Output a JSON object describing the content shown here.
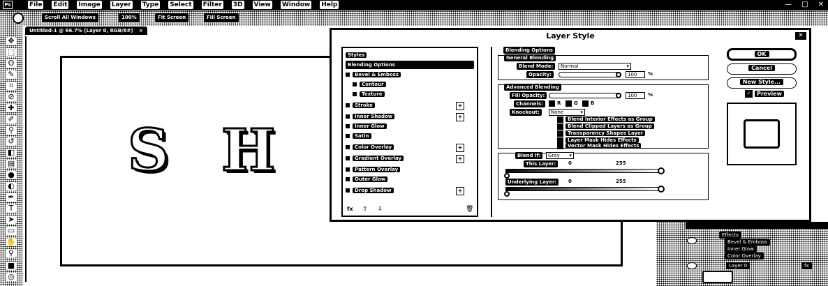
{
  "menubar": {
    "logo": "Ps",
    "items": [
      "File",
      "Edit",
      "Image",
      "Layer",
      "Type",
      "Select",
      "Filter",
      "3D",
      "View",
      "Window",
      "Help"
    ],
    "window_controls": [
      "—",
      "□",
      "✕"
    ]
  },
  "optbar": {
    "scroll_all": "Scroll All Windows",
    "zoom": "100%",
    "fit_screen": "Fit Screen",
    "fill_screen": "Fill Screen"
  },
  "doctab": {
    "title": "Untitled-1 @ 66.7% (Layer 0, RGB/8#)",
    "close": "×"
  },
  "canvas": {
    "letters": [
      "S",
      "H"
    ]
  },
  "dialog": {
    "title": "Layer Style",
    "close": "✕",
    "styles_header": "Styles",
    "styles": [
      {
        "label": "Blending Options",
        "selected": true,
        "checkbox": false,
        "plus": false
      },
      {
        "label": "Bevel & Emboss",
        "checkbox": true,
        "plus": false
      },
      {
        "label": "Contour",
        "checkbox": true,
        "plus": false
      },
      {
        "label": "Texture",
        "checkbox": true,
        "plus": false
      },
      {
        "label": "Stroke",
        "checkbox": true,
        "plus": true
      },
      {
        "label": "Inner Shadow",
        "checkbox": true,
        "plus": true
      },
      {
        "label": "Inner Glow",
        "checkbox": true,
        "plus": false
      },
      {
        "label": "Satin",
        "checkbox": true,
        "plus": false
      },
      {
        "label": "Color Overlay",
        "checkbox": true,
        "plus": true
      },
      {
        "label": "Gradient Overlay",
        "checkbox": true,
        "plus": true
      },
      {
        "label": "Pattern Overlay",
        "checkbox": true,
        "plus": false
      },
      {
        "label": "Outer Glow",
        "checkbox": true,
        "plus": false
      },
      {
        "label": "Drop Shadow",
        "checkbox": true,
        "plus": true
      }
    ],
    "list_footer_fx": "fx",
    "blending": {
      "section": "Blending Options",
      "general": "General Blending",
      "blend_mode_label": "Blend Mode:",
      "blend_mode_value": "Normal",
      "opacity_label": "Opacity:",
      "opacity_value": "100",
      "opacity_unit": "%",
      "advanced": "Advanced Blending",
      "fill_opacity_label": "Fill Opacity:",
      "fill_opacity_value": "100",
      "channels_label": "Channels:",
      "channel_r": "R",
      "channel_g": "G",
      "channel_b": "B",
      "knockout_label": "Knockout:",
      "knockout_value": "None",
      "checks": [
        "Blend Interior Effects as Group",
        "Blend Clipped Layers as Group",
        "Transparency Shapes Layer",
        "Layer Mask Hides Effects",
        "Vector Mask Hides Effects"
      ],
      "blend_if_label": "Blend If:",
      "blend_if_value": "Gray",
      "this_layer_label": "This Layer:",
      "this_layer_low": "0",
      "this_layer_high": "255",
      "underlying_label": "Underlying Layer:",
      "underlying_low": "0",
      "underlying_high": "255"
    },
    "buttons": {
      "ok": "OK",
      "cancel": "Cancel",
      "new_style": "New Style...",
      "preview": "Preview",
      "preview_check": "✓"
    }
  },
  "layers_panel": {
    "effects": [
      "Effects",
      "Bevel & Emboss",
      "Inner Glow",
      "Color Overlay"
    ],
    "layer_name": "Layer 0",
    "fx": "fx"
  }
}
